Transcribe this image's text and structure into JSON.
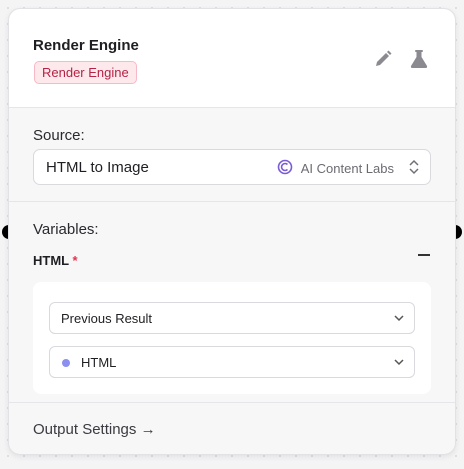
{
  "header": {
    "title": "Render Engine",
    "badge": "Render Engine",
    "icons": [
      "pencil-icon",
      "flask-icon"
    ]
  },
  "source": {
    "label": "Source:",
    "selected": "HTML to Image",
    "provider": "AI Content Labs"
  },
  "variables": {
    "label": "Variables:",
    "field_name": "HTML",
    "required_mark": "*",
    "mode_select": "Previous Result",
    "value_select": "HTML"
  },
  "output": {
    "link": "Output Settings →"
  },
  "colors": {
    "badge_text": "#b42346",
    "badge_bg": "#fde8ec",
    "required": "#e0344f",
    "value_dot": "#8a8ff0",
    "provider_logo": "#7b5cd6"
  }
}
